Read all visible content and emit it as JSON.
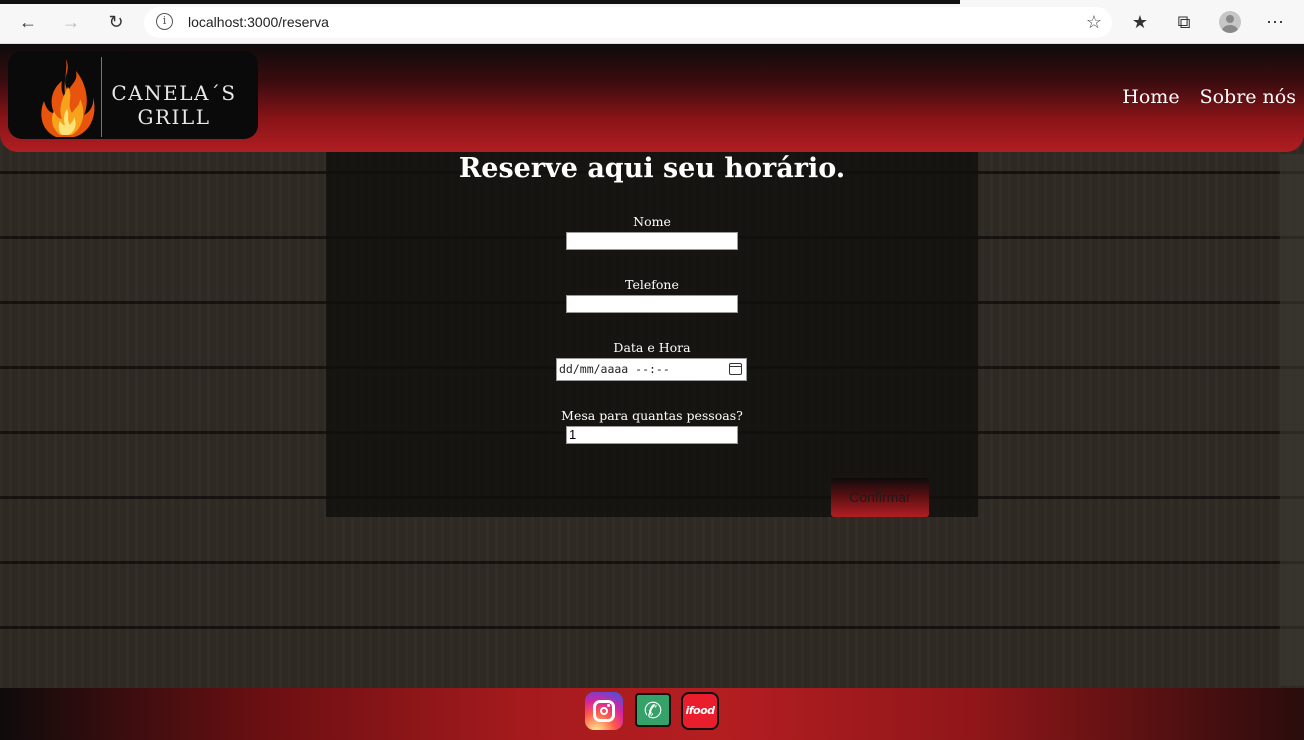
{
  "browser": {
    "url": "localhost:3000/reserva",
    "icons": [
      "back-arrow-icon",
      "forward-arrow-icon",
      "refresh-icon",
      "info-icon",
      "favorite-add-icon",
      "favorites-icon",
      "collections-icon",
      "profile-icon",
      "more-icon"
    ]
  },
  "header": {
    "logo_line1": "CANELA´S",
    "logo_line2": "GRILL",
    "nav": {
      "home": "Home",
      "about": "Sobre nós"
    }
  },
  "form": {
    "title": "Reserve aqui seu horário.",
    "name_label": "Nome",
    "name_value": "",
    "phone_label": "Telefone",
    "phone_value": "",
    "datetime_label": "Data e Hora",
    "datetime_placeholder": "dd/mm/aaaa --:--",
    "people_label": "Mesa para quantas pessoas?",
    "people_value": "1",
    "submit_label": "Confirmar"
  },
  "footer": {
    "icons": [
      "instagram-icon",
      "whatsapp-icon",
      "ifood-icon"
    ],
    "ifood_text": "ifood"
  },
  "colors": {
    "accent_red": "#b01e22",
    "header_dark": "#0d0b0b"
  }
}
